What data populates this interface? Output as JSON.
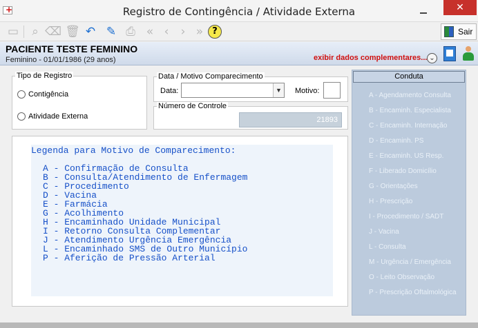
{
  "window": {
    "title": "Registro de Contingência / Atividade Externa",
    "close_glyph": "✕",
    "min_glyph": ""
  },
  "toolbar": {
    "sair_label": "Sair",
    "help_glyph": "?"
  },
  "patient": {
    "name": "PACIENTE TESTE FEMININO",
    "info": "Feminino - 01/01/1986 (29 anos)",
    "extra_link": "exibir dados complementares..."
  },
  "tipo_registro": {
    "title": "Tipo de Registro",
    "options": [
      "Contigência",
      "Atividade Externa"
    ]
  },
  "data_motivo": {
    "title": "Data / Motivo Comparecimento",
    "data_label": "Data:",
    "data_value": "",
    "motivo_label": "Motivo:",
    "motivo_value": ""
  },
  "controle": {
    "title": "Número de Controle",
    "value": "21893"
  },
  "legend": {
    "title": "Legenda para Motivo de Comparecimento:",
    "items": [
      "A - Confirmação de Consulta",
      "B - Consulta/Atendimento de Enfermagem",
      "C - Procedimento",
      "D - Vacina",
      "E - Farmácia",
      "G - Acolhimento",
      "H - Encaminhado Unidade Municipal",
      "I - Retorno Consulta Complementar",
      "J - Atendimento Urgência Emergência",
      "L - Encaminhado SMS de Outro Município",
      "P - Aferição de Pressão Arterial"
    ]
  },
  "conduta": {
    "title": "Conduta",
    "items": [
      "A - Agendamento Consulta",
      "B - Encaminh. Especialista",
      "C - Encaminh. Internação",
      "D - Encaminh. PS",
      "E - Encaminh. US Resp.",
      "F - Liberado Domicílio",
      "G - Orientações",
      "H - Prescrição",
      "I - Procedimento / SADT",
      "J - Vacina",
      "L - Consulta",
      "M - Urgência / Emergência",
      "O - Leito Observação",
      "P - Prescrição Oftalmológica"
    ]
  }
}
